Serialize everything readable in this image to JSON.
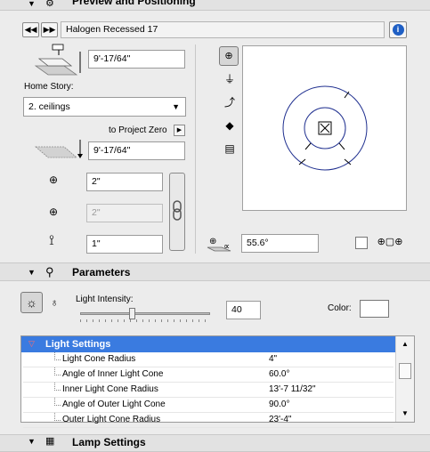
{
  "preview_section": {
    "title": "Preview and Positioning",
    "object_name": "Halogen Recessed 17",
    "prev_icon": "rewind-icon",
    "next_icon": "fast-forward-icon",
    "info_icon": "info-icon",
    "top_elevation_value": "9'-17/64\"",
    "home_story_label": "Home Story:",
    "home_story_value": "2. ceilings",
    "to_project_zero_label": "to Project Zero",
    "project_zero_value": "9'-17/64\"",
    "offset_x_value": "2\"",
    "offset_y_value": "2\"",
    "height_value": "1\"",
    "angle_value": "55.6°"
  },
  "parameters_section": {
    "title": "Parameters",
    "light_intensity_label": "Light Intensity:",
    "light_intensity_value": "40",
    "light_intensity_level": 0.4,
    "color_label": "Color:",
    "color_swatch": "#ffffff"
  },
  "light_settings": {
    "header": "Light Settings",
    "rows": [
      {
        "name": "Light Cone Radius",
        "value": "4\""
      },
      {
        "name": "Angle of Inner Light Cone",
        "value": "60.0°"
      },
      {
        "name": "Inner Light Cone Radius",
        "value": "13'-7 11/32\""
      },
      {
        "name": "Angle of Outer Light Cone",
        "value": "90.0°"
      },
      {
        "name": "Outer Light Cone Radius",
        "value": "23'-4\""
      }
    ]
  },
  "lamp_section": {
    "title": "Lamp Settings"
  },
  "colors": {
    "accent": "#3a7be0",
    "selection_blue": "#3a7be0",
    "plan_blue": "#1f2f8f"
  }
}
